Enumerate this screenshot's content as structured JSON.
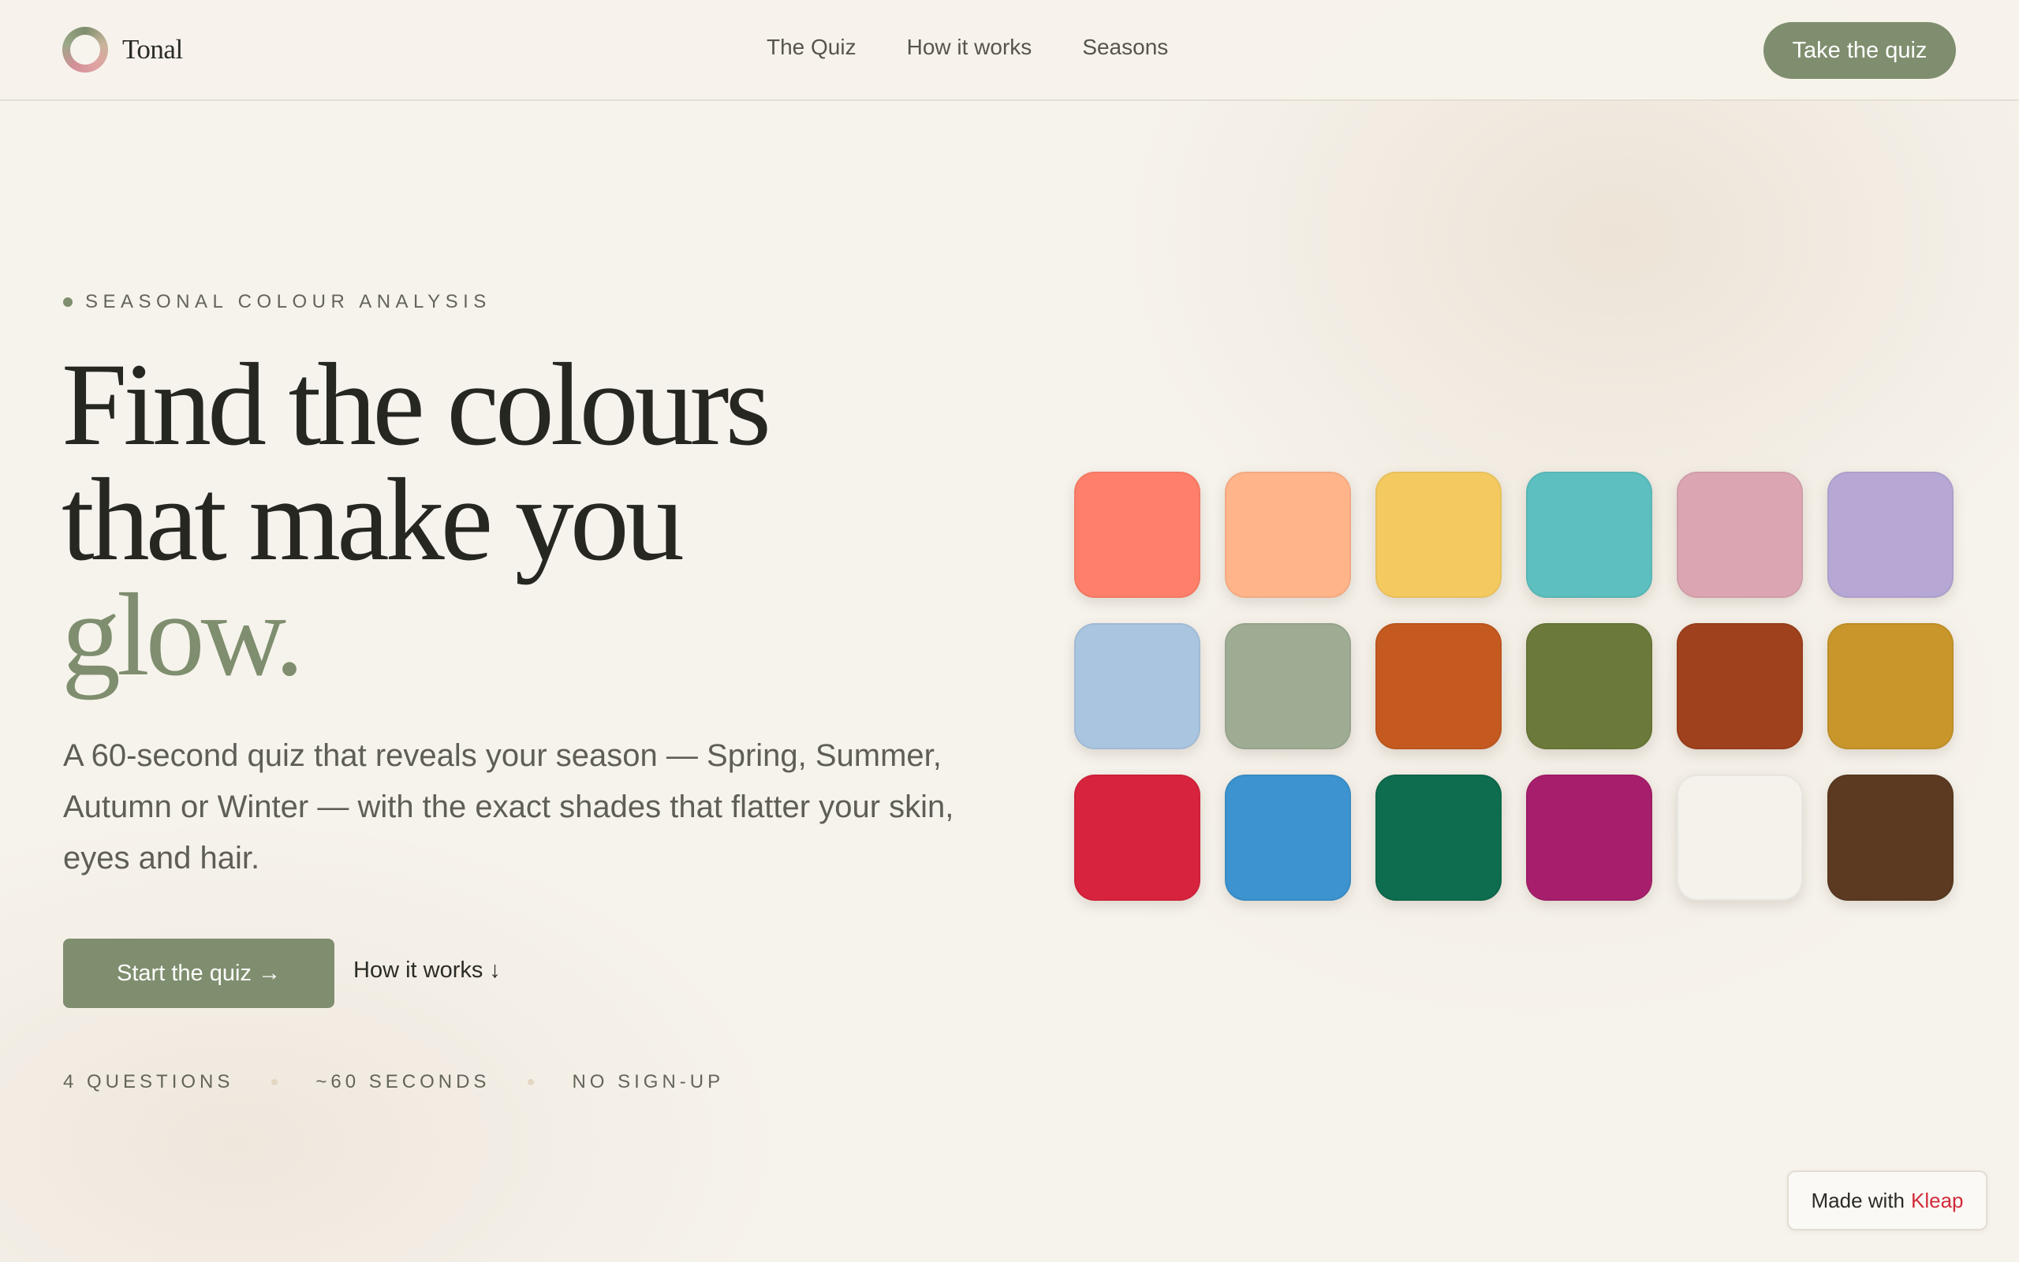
{
  "header": {
    "logo_text": "Tonal",
    "nav": [
      "The Quiz",
      "How it works",
      "Seasons"
    ],
    "cta": "Take the quiz"
  },
  "hero": {
    "eyebrow": "SEASONAL COLOUR ANALYSIS",
    "headline_line1": "Find the colours",
    "headline_line2": "that make you",
    "headline_accent": "glow.",
    "subhead": "A 60-second quiz that reveals your season — Spring, Summer, Autumn or Winter — with the exact shades that flatter your skin, eyes and hair.",
    "primary_button": "Start the quiz →",
    "secondary_button": "How it works ↓",
    "meta": [
      "4 QUESTIONS",
      "~60 SECONDS",
      "NO SIGN-UP"
    ]
  },
  "swatches": [
    "#ff7f6a",
    "#ffb48a",
    "#f4ca60",
    "#5dbfbf",
    "#dba6b2",
    "#b7a7d5",
    "#a9c5e0",
    "#9fac94",
    "#c55a20",
    "#6b7a3a",
    "#a0411d",
    "#c8962a",
    "#d8233e",
    "#3c93cf",
    "#0e6c4f",
    "#a71f6c",
    "#f5f2ec",
    "#5c3a22"
  ],
  "badge": {
    "prefix": "Made with",
    "brand": "Kleap"
  },
  "colors": {
    "accent": "#7f8e6e",
    "background": "#f6f3ec",
    "text": "#2b2b26",
    "badge_brand": "#d22c3a"
  }
}
